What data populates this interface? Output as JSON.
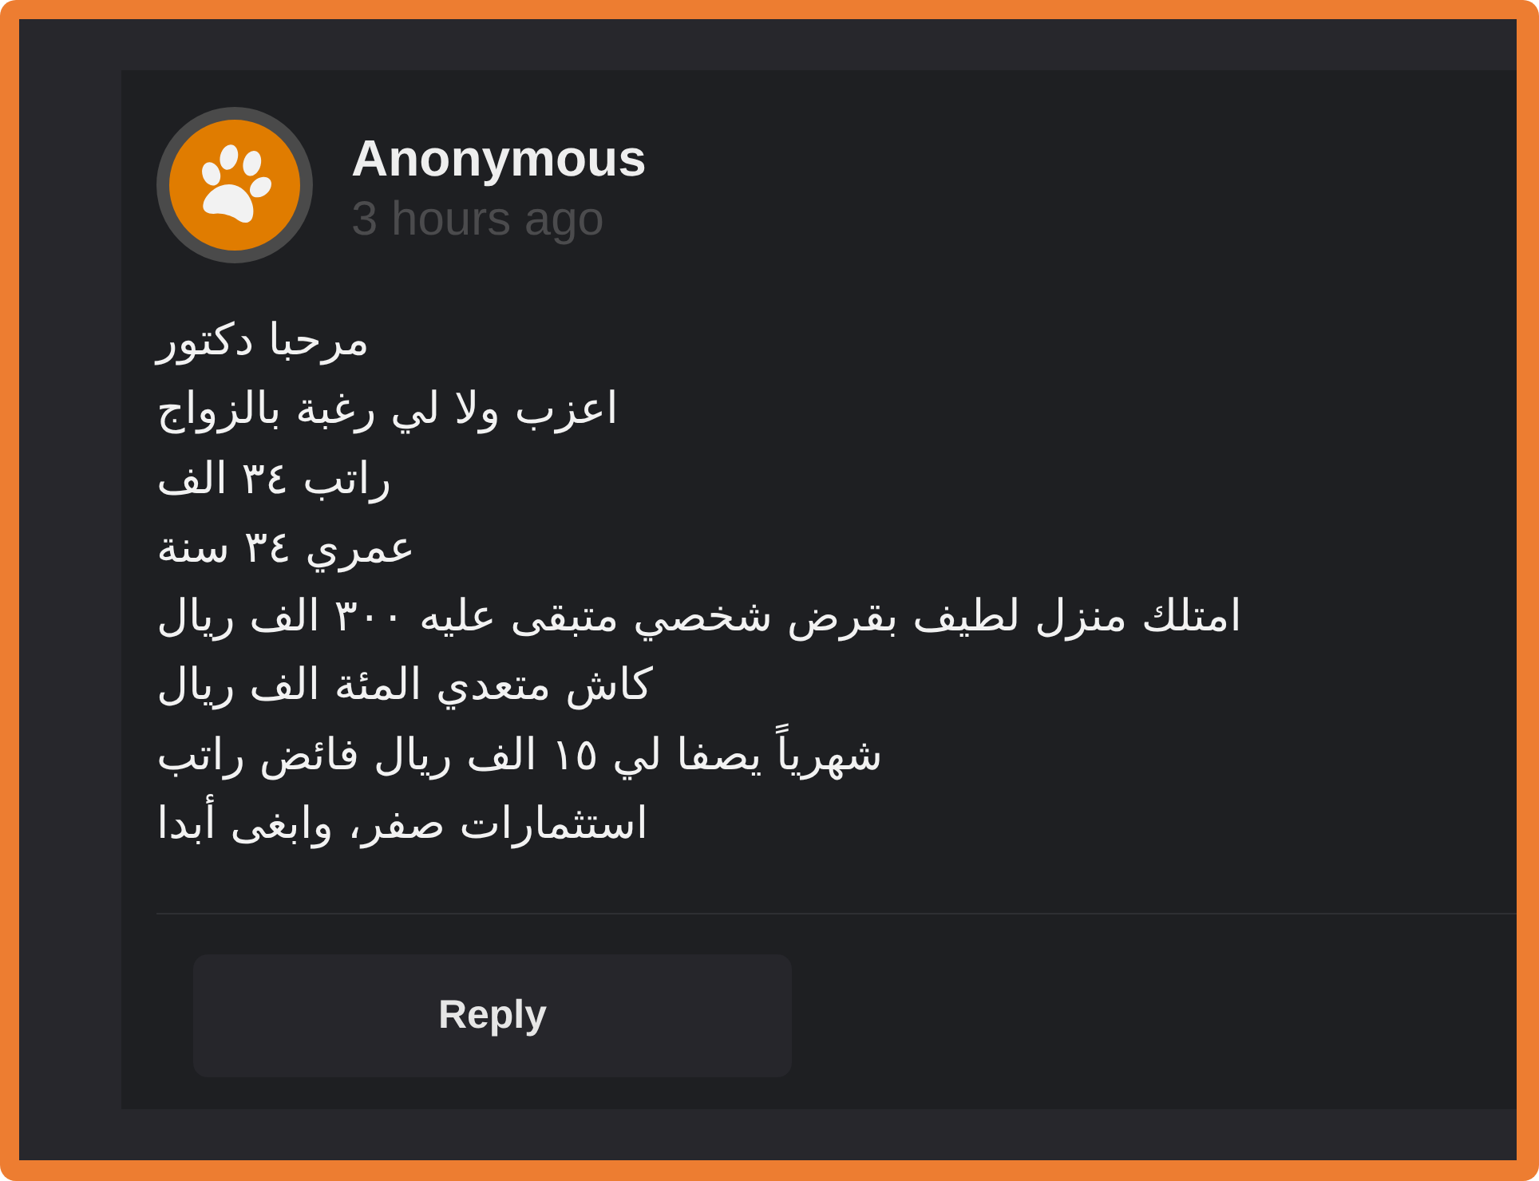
{
  "comment": {
    "author": "Anonymous",
    "time": "3 hours ago",
    "lines": [
      "مرحبا دكتور",
      "اعزب ولا لي رغبة بالزواج",
      "راتب ٣٤ الف",
      "عمري ٣٤ سنة",
      "امتلك منزل لطيف بقرض شخصي متبقى عليه ٣٠٠ الف ريال",
      "كاش متعدي المئة الف ريال",
      "شهرياً يصفا لي ١٥ الف ريال فائض راتب",
      "استثمارات صفر، وابغى أبدا"
    ]
  },
  "reply_button": {
    "label": "Reply"
  }
}
